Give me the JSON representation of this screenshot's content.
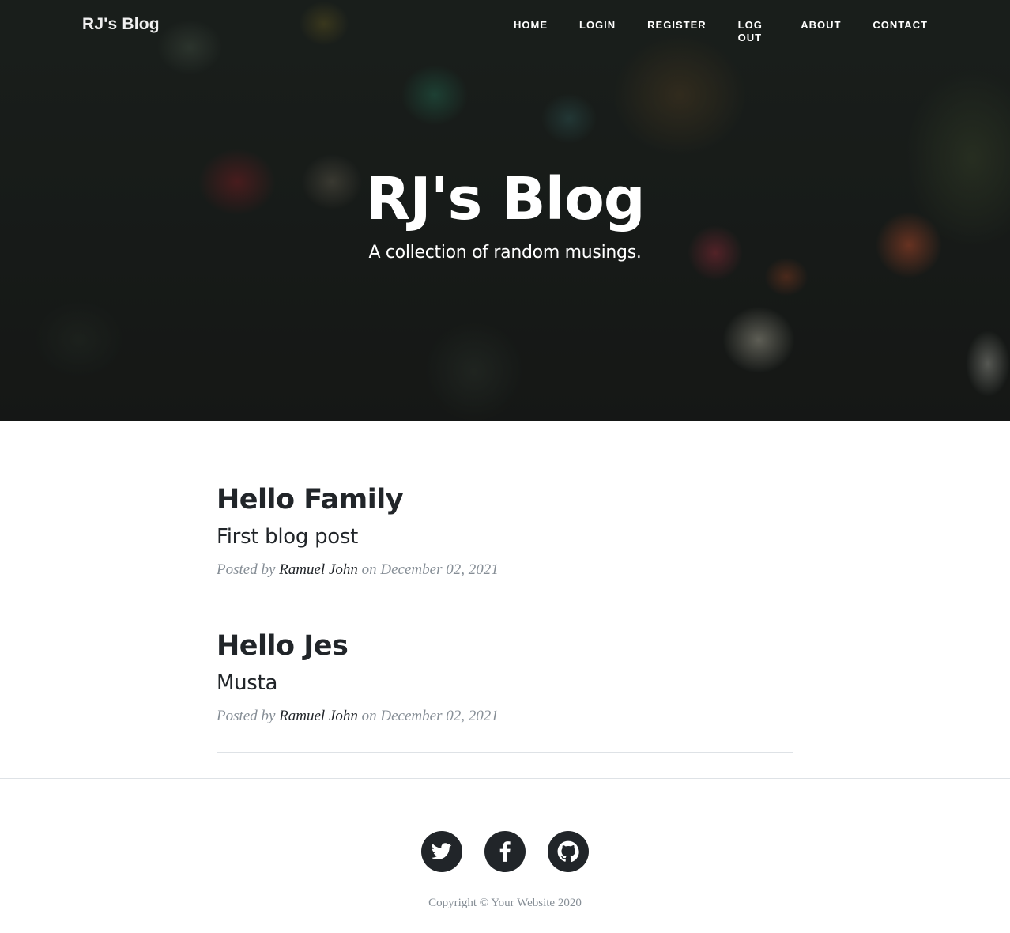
{
  "navbar": {
    "brand": "RJ's Blog",
    "links": [
      "HOME",
      "LOGIN",
      "REGISTER",
      "LOG OUT",
      "ABOUT",
      "CONTACT"
    ]
  },
  "hero": {
    "title": "RJ's Blog",
    "subtitle": "A collection of random musings."
  },
  "posts": [
    {
      "title": "Hello Family",
      "subtitle": "First blog post",
      "meta_prefix": "Posted by",
      "author": "Ramuel John",
      "meta_on": "on",
      "date": "December 02, 2021"
    },
    {
      "title": "Hello Jes",
      "subtitle": "Musta",
      "meta_prefix": "Posted by",
      "author": "Ramuel John",
      "meta_on": "on",
      "date": "December 02, 2021"
    }
  ],
  "footer": {
    "social_icons": [
      "twitter-icon",
      "facebook-icon",
      "github-icon"
    ],
    "copyright": "Copyright © Your Website 2020"
  },
  "colors": {
    "text_dark": "#212529",
    "text_muted": "#868e96",
    "divider": "#dee2e6"
  }
}
